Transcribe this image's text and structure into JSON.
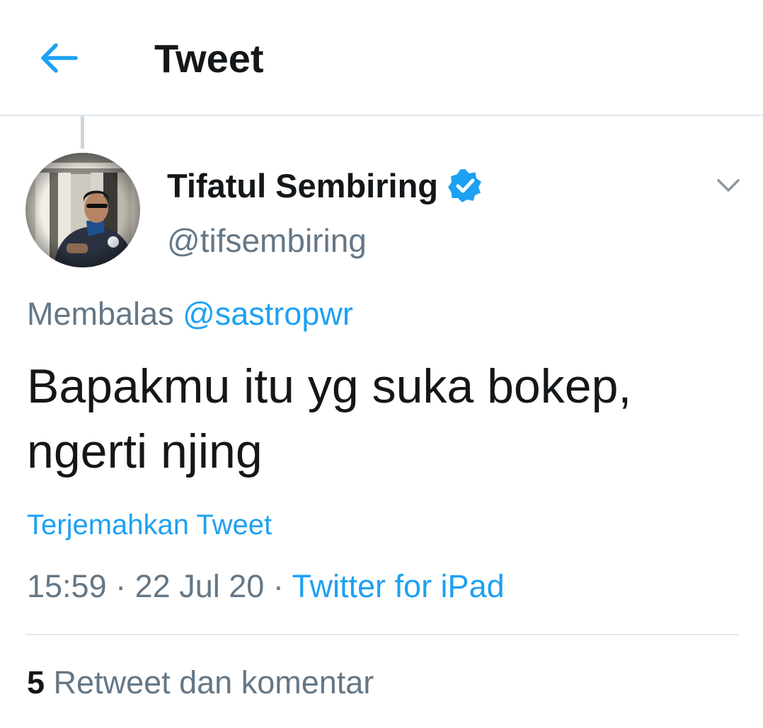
{
  "header": {
    "title": "Tweet",
    "back_icon": "arrow-left-icon"
  },
  "tweet": {
    "display_name": "Tifatul Sembiring",
    "handle": "@tifsembiring",
    "verified": true,
    "reply_prefix": "Membalas",
    "reply_to": "@sastropwr",
    "text_line1": "Bapakmu itu yg suka bokep,",
    "text_line2": "ngerti njing",
    "translate_label": "Terjemahkan Tweet",
    "time": "15:59",
    "date": "22 Jul 20",
    "separator": "·",
    "source": "Twitter for iPad",
    "retweet_count": "5",
    "retweet_label": "Retweet dan komentar"
  },
  "colors": {
    "accent": "#1da1f2",
    "text_primary": "#14171a",
    "text_secondary": "#657786",
    "divider": "#e1e8ed"
  }
}
